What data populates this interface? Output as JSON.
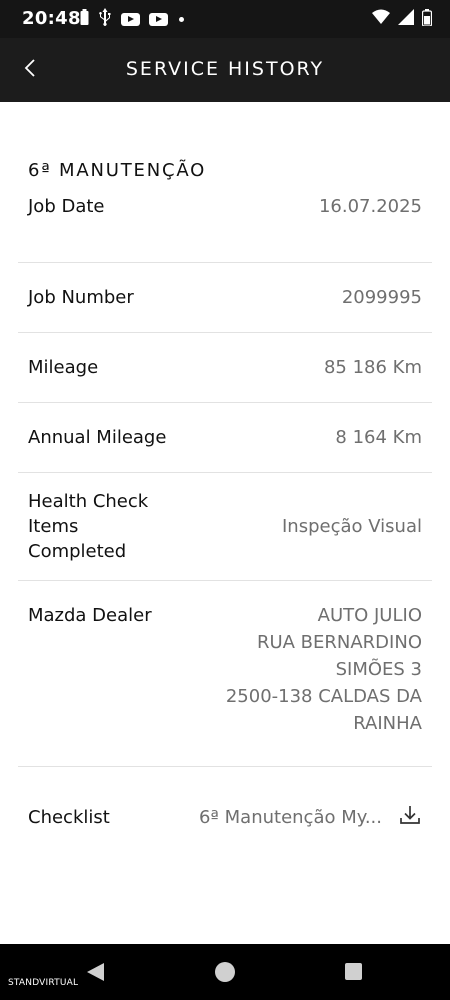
{
  "status_bar": {
    "time": "20:48",
    "icons": [
      "battery-saver-icon",
      "usb-icon",
      "youtube-icon",
      "youtube-icon",
      "notification-dot-icon",
      "wifi-icon",
      "signal-icon",
      "battery-icon"
    ]
  },
  "header": {
    "title": "SERVICE HISTORY",
    "back_icon": "chevron-left-icon"
  },
  "section": {
    "title": "6ª MANUTENÇÃO"
  },
  "rows": {
    "job_date": {
      "label": "Job Date",
      "value": "16.07.2025"
    },
    "job_number": {
      "label": "Job Number",
      "value": "2099995"
    },
    "mileage": {
      "label": "Mileage",
      "value": "85 186 Km"
    },
    "annual_mileage": {
      "label": "Annual Mileage",
      "value": "8 164 Km"
    },
    "health_check": {
      "label_lines": [
        "Health Check",
        "Items",
        "Completed"
      ],
      "value": "Inspeção Visual"
    },
    "dealer": {
      "label": "Mazda Dealer",
      "value_lines": [
        "AUTO JULIO",
        "RUA BERNARDINO",
        "SIMÕES 3",
        "2500-138 CALDAS DA",
        "RAINHA"
      ]
    },
    "checklist": {
      "label": "Checklist",
      "value": "6ª Manutenção My...",
      "icon": "download-icon"
    }
  },
  "watermark": "STANDVIRTUAL",
  "colors": {
    "header_bg": "#1c1c1c",
    "status_bg": "#151515",
    "value_text": "#6f6f6f",
    "divider": "#e2e2e2"
  }
}
